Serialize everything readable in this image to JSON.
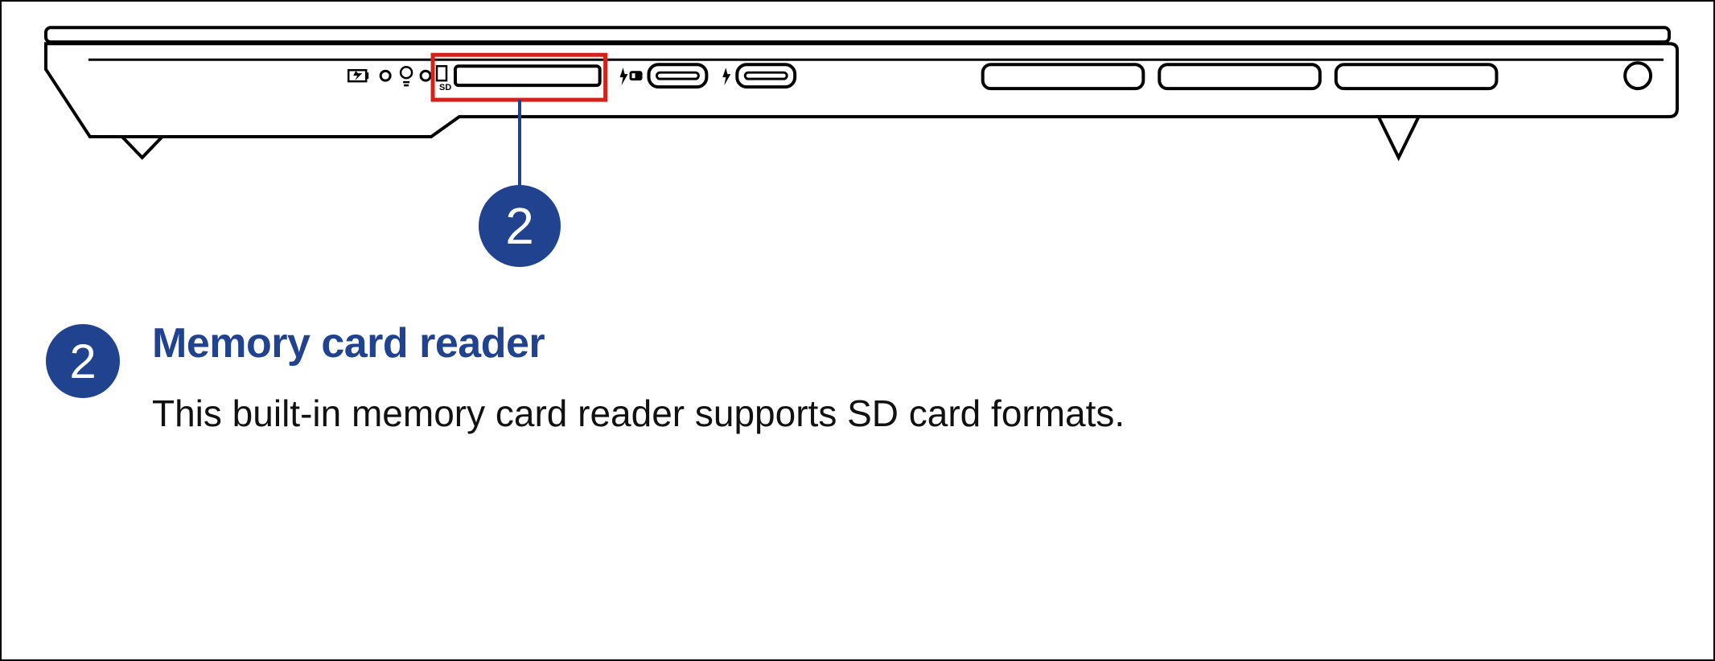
{
  "callout": {
    "number": "2",
    "sd_label": "SD"
  },
  "description": {
    "badge": "2",
    "title": "Memory card reader",
    "body": "This built-in memory card reader supports SD card formats."
  }
}
